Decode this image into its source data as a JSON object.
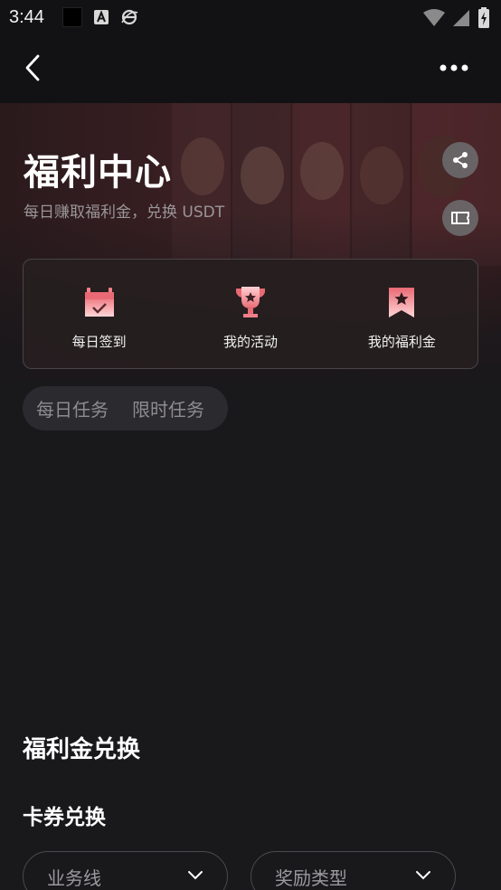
{
  "status_bar": {
    "time": "3:44",
    "icons": [
      "black-square-icon",
      "a-badge-icon",
      "e-browser-icon",
      "wifi-icon",
      "signal-icon",
      "battery-icon"
    ]
  },
  "header": {
    "title": "福利中心",
    "subtitle": "每日赚取福利金，兑换 USDT"
  },
  "quick_actions": [
    {
      "label": "每日签到",
      "icon": "calendar-check-icon"
    },
    {
      "label": "我的活动",
      "icon": "trophy-icon"
    },
    {
      "label": "我的福利金",
      "icon": "bookmark-star-icon"
    }
  ],
  "task_tabs": [
    "每日任务",
    "限时任务"
  ],
  "sections": {
    "exchange_title": "福利金兑换",
    "coupon_title": "卡券兑换"
  },
  "filters": [
    {
      "label": "业务线"
    },
    {
      "label": "奖励类型"
    }
  ],
  "colors": {
    "background": "#19181b",
    "accent": "#e8717a",
    "card_border": "#4a4446"
  }
}
